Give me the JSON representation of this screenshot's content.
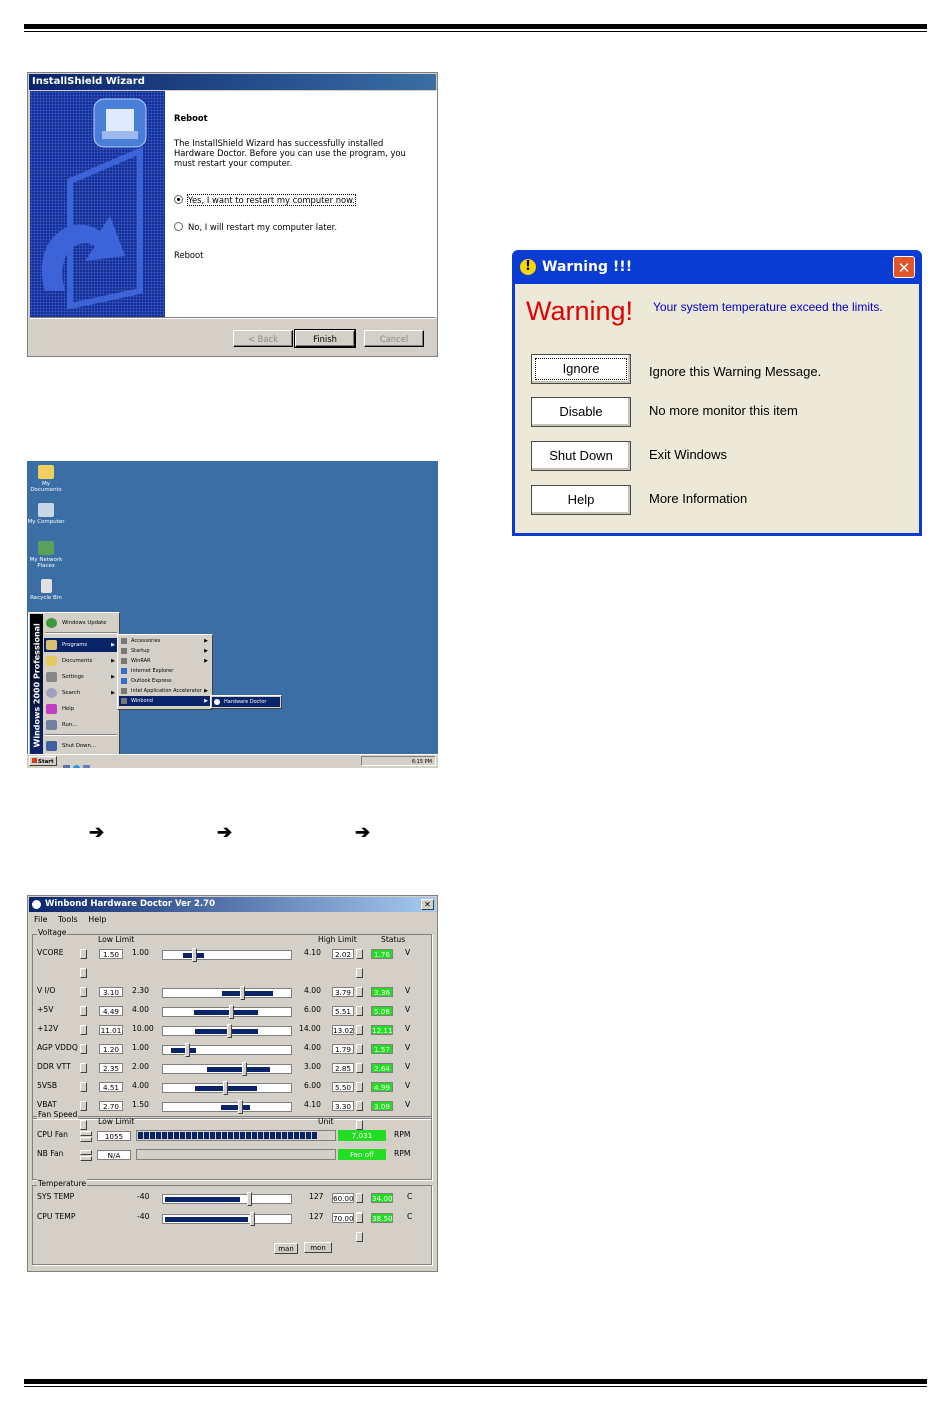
{
  "wizard": {
    "title": "InstallShield Wizard",
    "heading": "Reboot",
    "body": "The InstallShield Wizard has successfully installed Hardware Doctor.  Before you can use the program, you must restart your computer.",
    "option_yes": "Yes, I want to restart my computer now.",
    "option_no": "No, I will restart my computer later.",
    "footer_label": "Reboot",
    "back_button": "< Back",
    "finish_button": "Finish",
    "cancel_button": "Cancel"
  },
  "desktop": {
    "icons": [
      "My Documents",
      "My Computer",
      "My Network Places",
      "Recycle Bin"
    ],
    "start_band": "Windows 2000 Professional",
    "start_items": [
      "Windows Update",
      "Programs",
      "Documents",
      "Settings",
      "Search",
      "Help",
      "Run...",
      "Shut Down..."
    ],
    "programs_items": [
      "Accessories",
      "Startup",
      "WinRAR",
      "Internet Explorer",
      "Outlook Express",
      "Intel Application Accelerator",
      "Winbond"
    ],
    "winbond_items": [
      "Hardware Doctor"
    ],
    "start_button": "Start",
    "clock": "6:15 PM"
  },
  "arrows": [
    "➔",
    "➔",
    "➔"
  ],
  "hwd": {
    "title": "Winbond Hardware Doctor Ver 2.70",
    "menu": [
      "File",
      "Tools",
      "Help"
    ],
    "voltage_group": "Voltage",
    "low_limit_header": "Low Limit",
    "high_limit_header": "High Limit",
    "status_header": "Status",
    "voltages": [
      {
        "name": "VCORE",
        "low_limit": "1.50",
        "min": "1.00",
        "max": "4.10",
        "high_limit": "2.02",
        "status": "1.76",
        "unit": "V"
      },
      {
        "name": "V I/O",
        "low_limit": "3.10",
        "min": "2.30",
        "max": "4.00",
        "high_limit": "3.79",
        "status": "3.36",
        "unit": "V"
      },
      {
        "name": "+5V",
        "low_limit": "4.49",
        "min": "4.00",
        "max": "6.00",
        "high_limit": "5.51",
        "status": "5.08",
        "unit": "V"
      },
      {
        "name": "+12V",
        "low_limit": "11.01",
        "min": "10.00",
        "max": "14.00",
        "high_limit": "13.02",
        "status": "12.11",
        "unit": "V"
      },
      {
        "name": "AGP VDDQ",
        "low_limit": "1.20",
        "min": "1.00",
        "max": "4.00",
        "high_limit": "1.79",
        "status": "1.57",
        "unit": "V"
      },
      {
        "name": "DDR VTT",
        "low_limit": "2.35",
        "min": "2.00",
        "max": "3.00",
        "high_limit": "2.85",
        "status": "2.64",
        "unit": "V"
      },
      {
        "name": "5VSB",
        "low_limit": "4.51",
        "min": "4.00",
        "max": "6.00",
        "high_limit": "5.50",
        "status": "4.99",
        "unit": "V"
      },
      {
        "name": "VBAT",
        "low_limit": "2.70",
        "min": "1.50",
        "max": "4.10",
        "high_limit": "3.30",
        "status": "3.09",
        "unit": "V"
      }
    ],
    "fan_group": "Fan Speed",
    "fan_low_limit_header": "Low Limit",
    "fan_unit_header": "Unit",
    "fans": [
      {
        "name": "CPU Fan",
        "low_limit": "1055",
        "status": "7,031",
        "unit": "RPM",
        "level": 0.9
      },
      {
        "name": "NB Fan",
        "low_limit": "N/A",
        "status": "Fan off",
        "unit": "RPM",
        "level": 0
      }
    ],
    "temp_group": "Temperature",
    "temps": [
      {
        "name": "SYS TEMP",
        "min": "-40",
        "max": "127",
        "high_limit": "60.00",
        "status": "34.00",
        "unit": "C"
      },
      {
        "name": "CPU TEMP",
        "min": "-40",
        "max": "127",
        "high_limit": "70.00",
        "status": "38.50",
        "unit": "C"
      }
    ],
    "btn_left": "man",
    "btn_right": "mon"
  },
  "warning": {
    "title": "Warning !!!",
    "headline": "Warning!",
    "message": "Your system temperature exceed the limits.",
    "buttons": [
      {
        "label": "Ignore",
        "desc": "Ignore this Warning Message."
      },
      {
        "label": "Disable",
        "desc": "No more monitor this item"
      },
      {
        "label": "Shut Down",
        "desc": "Exit Windows"
      },
      {
        "label": "Help",
        "desc": "More Information"
      }
    ],
    "colors": {
      "headline": "#e30000",
      "message": "#0000cc",
      "titlebar": "#0a3cd4"
    }
  }
}
